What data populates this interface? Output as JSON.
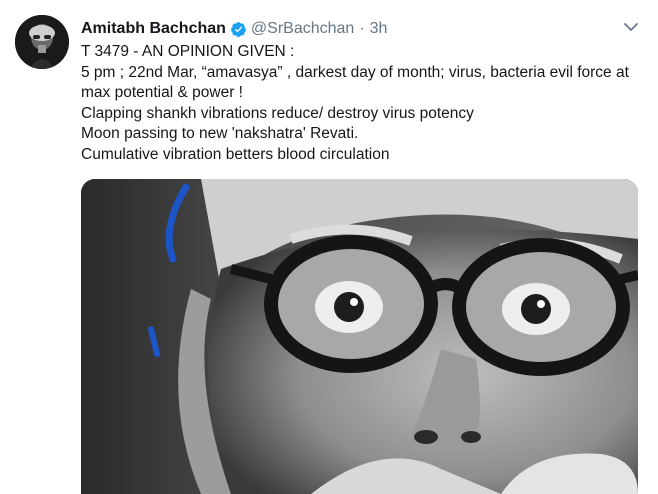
{
  "tweet": {
    "author_name": "Amitabh Bachchan",
    "handle": "@SrBachchan",
    "separator": "·",
    "time": "3h",
    "verified": true,
    "lines": [
      "T 3479 - AN OPINION GIVEN :",
      "5 pm ; 22nd Mar, “amavasya” , darkest day of month; virus, bacteria evil force at max potential & power !",
      "Clapping shankh vibrations reduce/ destroy virus potency",
      "Moon passing to new 'nakshatra' Revati.",
      "Cumulative vibration betters blood circulation"
    ]
  },
  "icons": {
    "verified": "verified-badge-icon",
    "caret": "chevron-down-icon"
  },
  "colors": {
    "verified_blue": "#1da1f2",
    "secondary_text": "#657786",
    "primary_text": "#14171a"
  }
}
